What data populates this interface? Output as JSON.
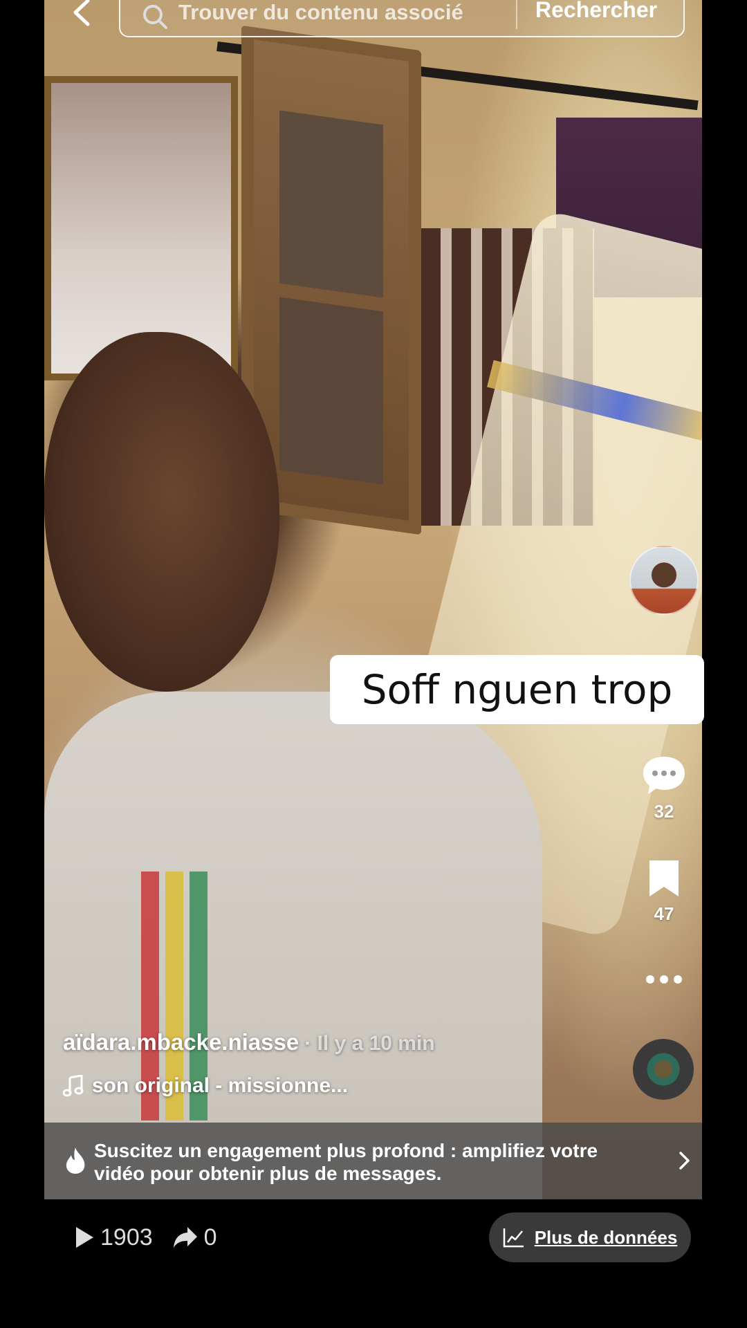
{
  "search": {
    "placeholder": "Trouver du contenu associé",
    "button": "Rechercher"
  },
  "video": {
    "caption": "Soff nguen trop",
    "username": "aïdara.mbacke.niasse",
    "timestamp": "· Il y a 10 min",
    "music": "son original - missionne..."
  },
  "rail": {
    "comments_count": "32",
    "bookmarks_count": "47"
  },
  "promo": {
    "text": "Suscitez un engagement plus profond : amplifiez votre vidéo pour obtenir plus de messages."
  },
  "stats": {
    "views": "1903",
    "shares": "0",
    "data_button": "Plus de données"
  },
  "icons": {
    "back": "chevron-left-icon",
    "search": "search-icon",
    "comment": "comment-bubble-icon",
    "bookmark": "bookmark-icon",
    "more": "more-dots-icon",
    "music": "music-note-icon",
    "flame": "flame-icon",
    "chevron": "chevron-right-icon",
    "play": "play-icon",
    "share": "share-arrow-icon",
    "chart": "chart-line-icon"
  },
  "colors": {
    "background": "#000000",
    "caption_bg": "#ffffff",
    "banner_bg": "#464646",
    "data_button_bg": "#3a3a3a"
  }
}
